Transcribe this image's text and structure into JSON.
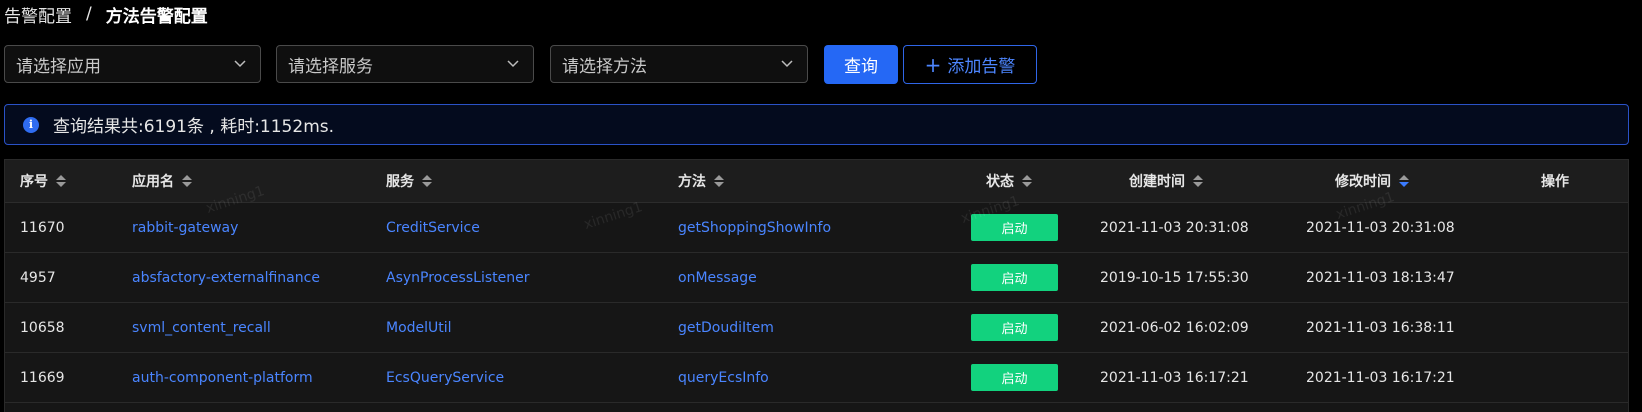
{
  "breadcrumb": {
    "parent": "告警配置",
    "separator": "/",
    "current": "方法告警配置"
  },
  "filters": {
    "app_placeholder": "请选择应用",
    "service_placeholder": "请选择服务",
    "method_placeholder": "请选择方法"
  },
  "buttons": {
    "query": "查询",
    "add_alert": "添加告警"
  },
  "alert": {
    "message": "查询结果共:6191条 , 耗时:1152ms."
  },
  "table": {
    "headers": {
      "id": "序号",
      "app": "应用名",
      "service": "服务",
      "method": "方法",
      "status": "状态",
      "created": "创建时间",
      "modified": "修改时间",
      "action": "操作"
    },
    "rows": [
      {
        "id": "11670",
        "app": "rabbit-gateway",
        "service": "CreditService",
        "method": "getShoppingShowInfo",
        "status": "启动",
        "created": "2021-11-03 20:31:08",
        "modified": "2021-11-03 20:31:08"
      },
      {
        "id": "4957",
        "app": "absfactory-externalfinance",
        "service": "AsynProcessListener",
        "method": "onMessage",
        "status": "启动",
        "created": "2019-10-15 17:55:30",
        "modified": "2021-11-03 18:13:47"
      },
      {
        "id": "10658",
        "app": "svml_content_recall",
        "service": "ModelUtil",
        "method": "getDoudiItem",
        "status": "启动",
        "created": "2021-06-02 16:02:09",
        "modified": "2021-11-03 16:38:11"
      },
      {
        "id": "11669",
        "app": "auth-component-platform",
        "service": "EcsQueryService",
        "method": "queryEcsInfo",
        "status": "启动",
        "created": "2021-11-03 16:17:21",
        "modified": "2021-11-03 16:17:21"
      }
    ]
  },
  "watermark": "xinning1",
  "colors": {
    "primary": "#2568f5",
    "link": "#4a85ff",
    "status_on": "#12d27e",
    "background": "#000000"
  }
}
